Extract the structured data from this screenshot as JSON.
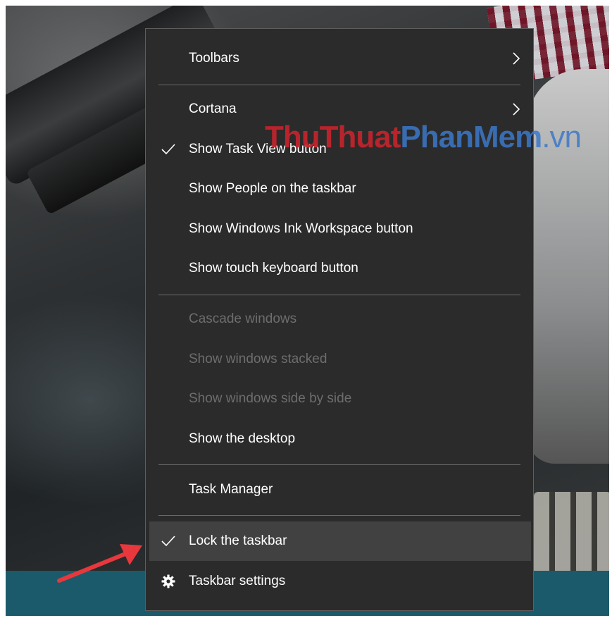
{
  "menu": {
    "items": [
      {
        "label": "Toolbars",
        "checked": false,
        "submenu": true,
        "disabled": false
      },
      {
        "label": "Cortana",
        "checked": false,
        "submenu": true,
        "disabled": false
      },
      {
        "label": "Show Task View button",
        "checked": true,
        "submenu": false,
        "disabled": false
      },
      {
        "label": "Show People on the taskbar",
        "checked": false,
        "submenu": false,
        "disabled": false
      },
      {
        "label": "Show Windows Ink Workspace button",
        "checked": false,
        "submenu": false,
        "disabled": false
      },
      {
        "label": "Show touch keyboard button",
        "checked": false,
        "submenu": false,
        "disabled": false
      },
      {
        "label": "Cascade windows",
        "checked": false,
        "submenu": false,
        "disabled": true
      },
      {
        "label": "Show windows stacked",
        "checked": false,
        "submenu": false,
        "disabled": true
      },
      {
        "label": "Show windows side by side",
        "checked": false,
        "submenu": false,
        "disabled": true
      },
      {
        "label": "Show the desktop",
        "checked": false,
        "submenu": false,
        "disabled": false
      },
      {
        "label": "Task Manager",
        "checked": false,
        "submenu": false,
        "disabled": false
      },
      {
        "label": "Lock the taskbar",
        "checked": true,
        "submenu": false,
        "disabled": false,
        "highlighted": true
      },
      {
        "label": "Taskbar settings",
        "checked": false,
        "submenu": false,
        "disabled": false,
        "icon": "gear-icon"
      }
    ]
  },
  "watermark": {
    "part1": "ThuThuat",
    "part2": "PhanMem",
    "part3": ".vn"
  },
  "colors": {
    "menu_bg": "#2b2b2b",
    "menu_highlight": "#414141",
    "text": "#ffffff",
    "disabled_text": "#6d6d6d",
    "taskbar": "#1b5a6b",
    "arrow": "#e8383d"
  }
}
